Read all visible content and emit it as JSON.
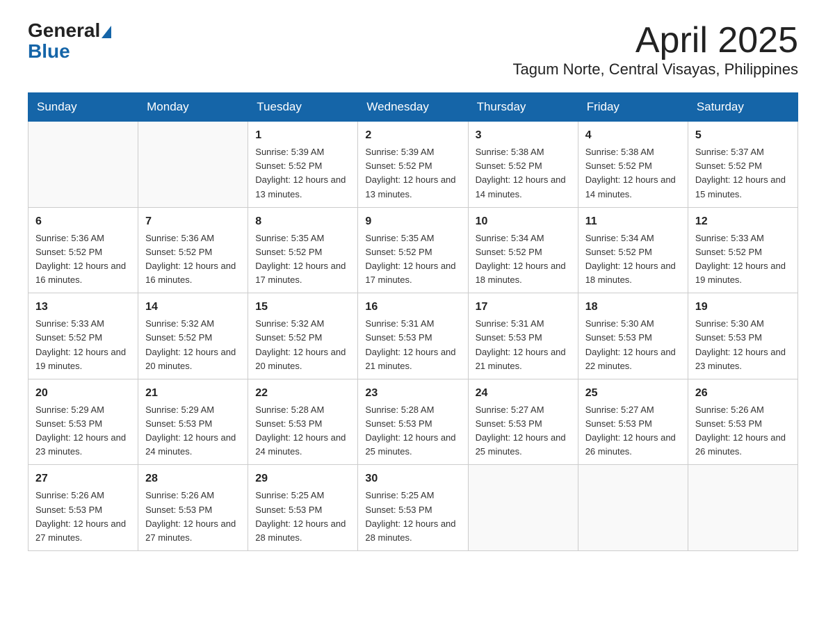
{
  "header": {
    "logo_general": "General",
    "logo_blue": "Blue",
    "month": "April 2025",
    "location": "Tagum Norte, Central Visayas, Philippines"
  },
  "weekdays": [
    "Sunday",
    "Monday",
    "Tuesday",
    "Wednesday",
    "Thursday",
    "Friday",
    "Saturday"
  ],
  "weeks": [
    [
      {
        "day": "",
        "info": ""
      },
      {
        "day": "",
        "info": ""
      },
      {
        "day": "1",
        "info": "Sunrise: 5:39 AM\nSunset: 5:52 PM\nDaylight: 12 hours\nand 13 minutes."
      },
      {
        "day": "2",
        "info": "Sunrise: 5:39 AM\nSunset: 5:52 PM\nDaylight: 12 hours\nand 13 minutes."
      },
      {
        "day": "3",
        "info": "Sunrise: 5:38 AM\nSunset: 5:52 PM\nDaylight: 12 hours\nand 14 minutes."
      },
      {
        "day": "4",
        "info": "Sunrise: 5:38 AM\nSunset: 5:52 PM\nDaylight: 12 hours\nand 14 minutes."
      },
      {
        "day": "5",
        "info": "Sunrise: 5:37 AM\nSunset: 5:52 PM\nDaylight: 12 hours\nand 15 minutes."
      }
    ],
    [
      {
        "day": "6",
        "info": "Sunrise: 5:36 AM\nSunset: 5:52 PM\nDaylight: 12 hours\nand 16 minutes."
      },
      {
        "day": "7",
        "info": "Sunrise: 5:36 AM\nSunset: 5:52 PM\nDaylight: 12 hours\nand 16 minutes."
      },
      {
        "day": "8",
        "info": "Sunrise: 5:35 AM\nSunset: 5:52 PM\nDaylight: 12 hours\nand 17 minutes."
      },
      {
        "day": "9",
        "info": "Sunrise: 5:35 AM\nSunset: 5:52 PM\nDaylight: 12 hours\nand 17 minutes."
      },
      {
        "day": "10",
        "info": "Sunrise: 5:34 AM\nSunset: 5:52 PM\nDaylight: 12 hours\nand 18 minutes."
      },
      {
        "day": "11",
        "info": "Sunrise: 5:34 AM\nSunset: 5:52 PM\nDaylight: 12 hours\nand 18 minutes."
      },
      {
        "day": "12",
        "info": "Sunrise: 5:33 AM\nSunset: 5:52 PM\nDaylight: 12 hours\nand 19 minutes."
      }
    ],
    [
      {
        "day": "13",
        "info": "Sunrise: 5:33 AM\nSunset: 5:52 PM\nDaylight: 12 hours\nand 19 minutes."
      },
      {
        "day": "14",
        "info": "Sunrise: 5:32 AM\nSunset: 5:52 PM\nDaylight: 12 hours\nand 20 minutes."
      },
      {
        "day": "15",
        "info": "Sunrise: 5:32 AM\nSunset: 5:52 PM\nDaylight: 12 hours\nand 20 minutes."
      },
      {
        "day": "16",
        "info": "Sunrise: 5:31 AM\nSunset: 5:53 PM\nDaylight: 12 hours\nand 21 minutes."
      },
      {
        "day": "17",
        "info": "Sunrise: 5:31 AM\nSunset: 5:53 PM\nDaylight: 12 hours\nand 21 minutes."
      },
      {
        "day": "18",
        "info": "Sunrise: 5:30 AM\nSunset: 5:53 PM\nDaylight: 12 hours\nand 22 minutes."
      },
      {
        "day": "19",
        "info": "Sunrise: 5:30 AM\nSunset: 5:53 PM\nDaylight: 12 hours\nand 23 minutes."
      }
    ],
    [
      {
        "day": "20",
        "info": "Sunrise: 5:29 AM\nSunset: 5:53 PM\nDaylight: 12 hours\nand 23 minutes."
      },
      {
        "day": "21",
        "info": "Sunrise: 5:29 AM\nSunset: 5:53 PM\nDaylight: 12 hours\nand 24 minutes."
      },
      {
        "day": "22",
        "info": "Sunrise: 5:28 AM\nSunset: 5:53 PM\nDaylight: 12 hours\nand 24 minutes."
      },
      {
        "day": "23",
        "info": "Sunrise: 5:28 AM\nSunset: 5:53 PM\nDaylight: 12 hours\nand 25 minutes."
      },
      {
        "day": "24",
        "info": "Sunrise: 5:27 AM\nSunset: 5:53 PM\nDaylight: 12 hours\nand 25 minutes."
      },
      {
        "day": "25",
        "info": "Sunrise: 5:27 AM\nSunset: 5:53 PM\nDaylight: 12 hours\nand 26 minutes."
      },
      {
        "day": "26",
        "info": "Sunrise: 5:26 AM\nSunset: 5:53 PM\nDaylight: 12 hours\nand 26 minutes."
      }
    ],
    [
      {
        "day": "27",
        "info": "Sunrise: 5:26 AM\nSunset: 5:53 PM\nDaylight: 12 hours\nand 27 minutes."
      },
      {
        "day": "28",
        "info": "Sunrise: 5:26 AM\nSunset: 5:53 PM\nDaylight: 12 hours\nand 27 minutes."
      },
      {
        "day": "29",
        "info": "Sunrise: 5:25 AM\nSunset: 5:53 PM\nDaylight: 12 hours\nand 28 minutes."
      },
      {
        "day": "30",
        "info": "Sunrise: 5:25 AM\nSunset: 5:53 PM\nDaylight: 12 hours\nand 28 minutes."
      },
      {
        "day": "",
        "info": ""
      },
      {
        "day": "",
        "info": ""
      },
      {
        "day": "",
        "info": ""
      }
    ]
  ]
}
